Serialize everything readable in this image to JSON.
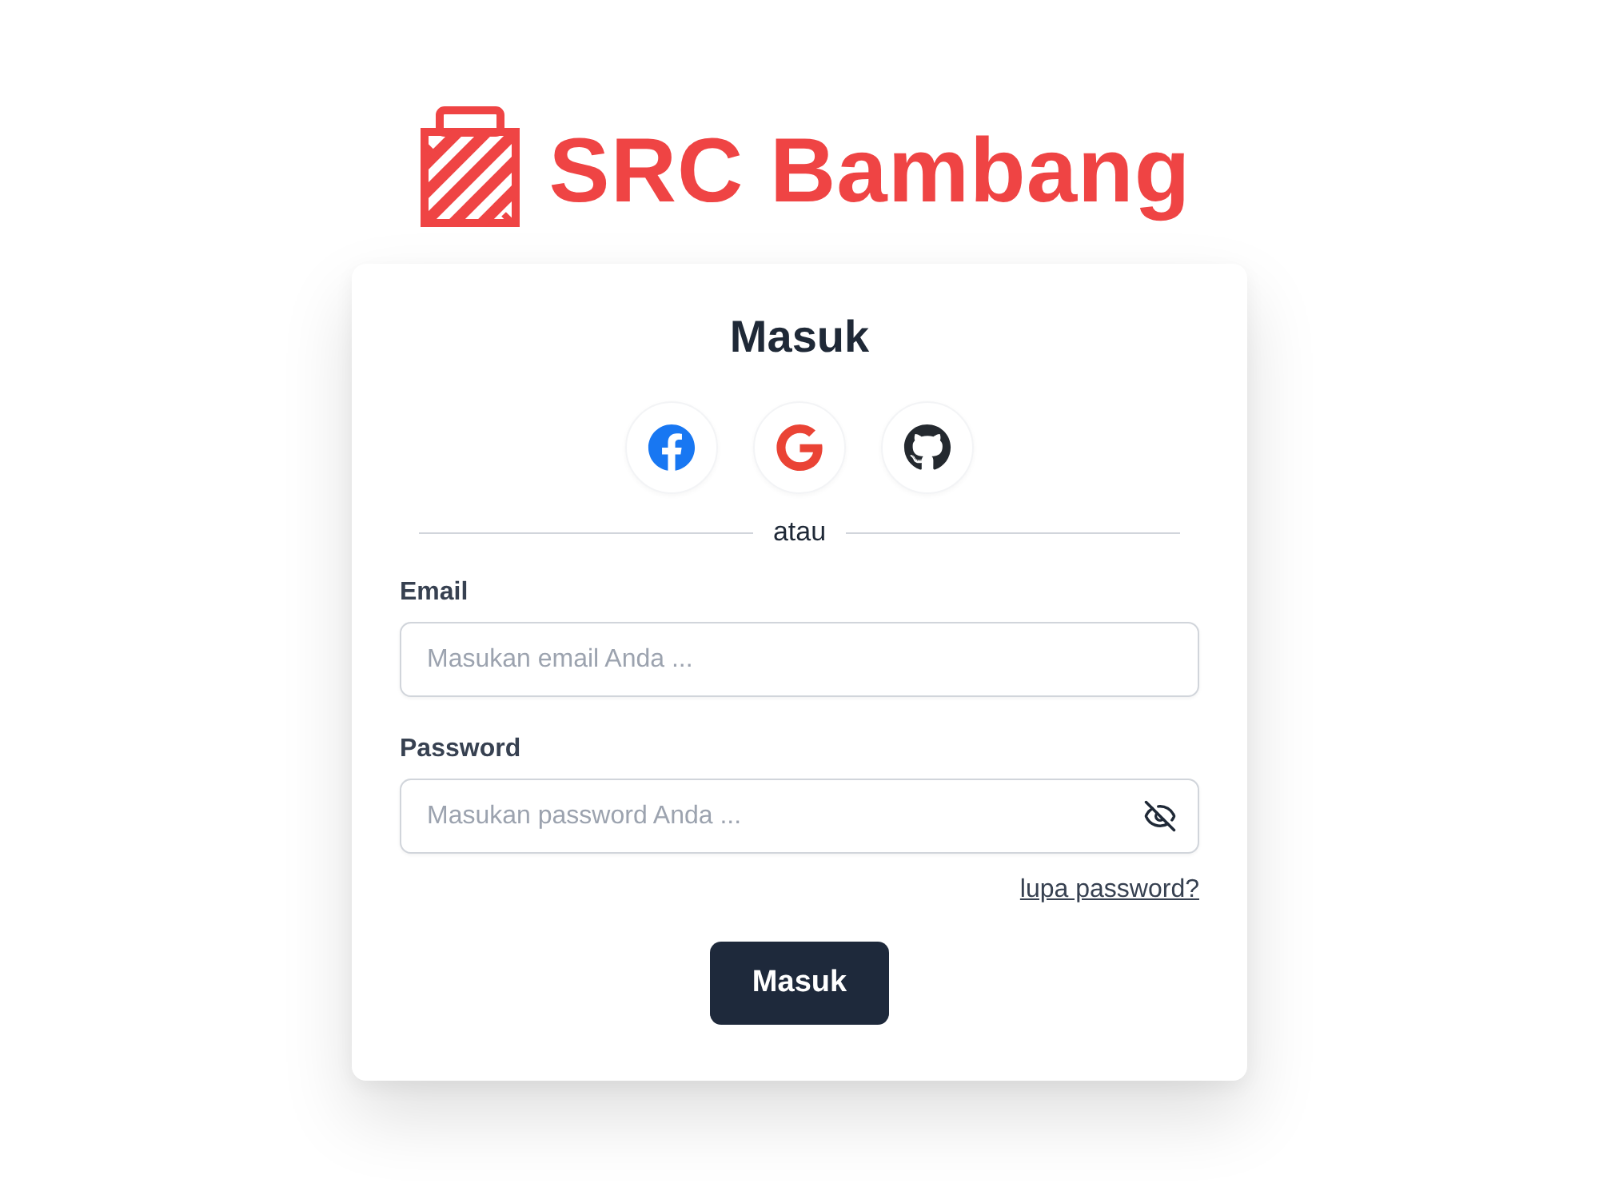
{
  "logo": {
    "text": "SRC Bambang"
  },
  "card": {
    "title": "Masuk",
    "social_buttons": [
      {
        "kind": "facebook"
      },
      {
        "kind": "google"
      },
      {
        "kind": "github"
      }
    ],
    "divider": "atau",
    "fields": [
      {
        "kind": "email",
        "label": "Email",
        "placeholder": "Masukan email Anda ..."
      },
      {
        "kind": "password",
        "label": "Password",
        "placeholder": "Masukan password Anda ..."
      }
    ],
    "forgot_link": "lupa password?",
    "submit": "Masuk"
  }
}
